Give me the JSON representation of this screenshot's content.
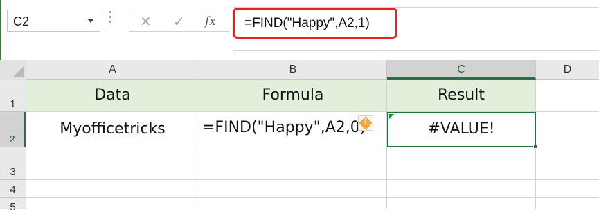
{
  "name_box": {
    "value": "C2"
  },
  "formula_bar": {
    "cancel_icon": "✕",
    "enter_icon": "✓",
    "fx_label": "fx",
    "formula": "=FIND(\"Happy\",A2,1)"
  },
  "columns": [
    "A",
    "B",
    "C",
    "D"
  ],
  "rows": [
    "1",
    "2",
    "3",
    "4",
    "5"
  ],
  "cells": {
    "A1": "Data",
    "B1": "Formula",
    "C1": "Result",
    "A2": "Myofficetricks",
    "B2": "=FIND(\"Happy\",A2,0)",
    "C2": "#VALUE!"
  },
  "colors": {
    "header_fill": "#e2efda",
    "selection": "#217346",
    "highlight_box": "#e8201e",
    "warning": "#f0a63c"
  },
  "icons": {
    "warning": "!"
  }
}
